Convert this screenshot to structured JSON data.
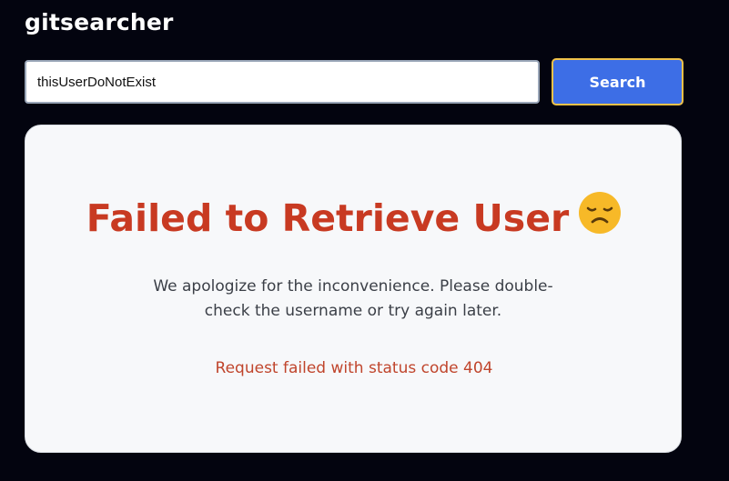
{
  "header": {
    "app_title": "gitsearcher"
  },
  "search": {
    "value": "thisUserDoNotExist",
    "button_label": "Search"
  },
  "error": {
    "title": "Failed to Retrieve User",
    "icon": "sad-face-icon",
    "message": "We apologize for the inconvenience. Please double-check the username or try again later.",
    "status": "Request failed with status code 404"
  },
  "colors": {
    "background": "#03040f",
    "accent": "#3d6ee6",
    "button_border": "#f0c24a",
    "error": "#c83a22",
    "card": "#f7f8fa"
  }
}
